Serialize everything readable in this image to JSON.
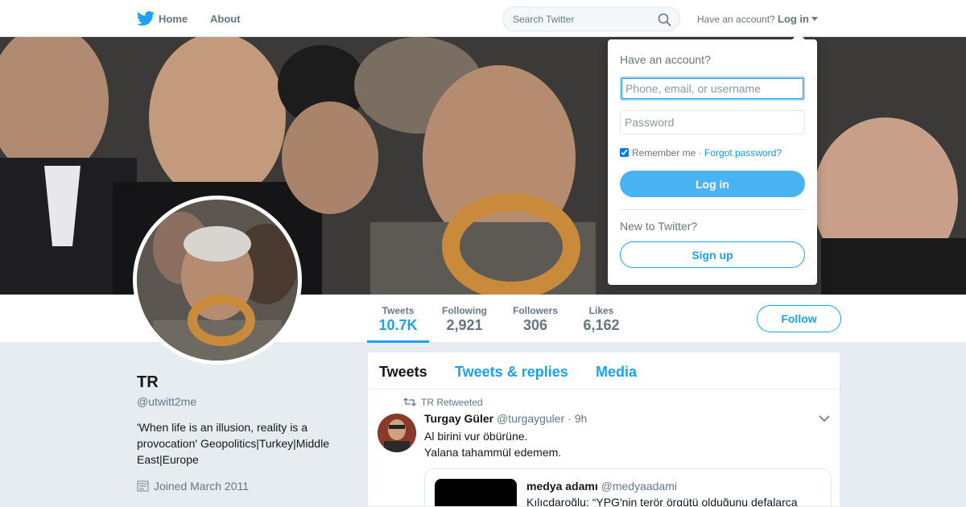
{
  "nav": {
    "home_label": "Home",
    "about_label": "About",
    "search_placeholder": "Search Twitter",
    "have_account": "Have an account?",
    "login_label": "Log in",
    "brand_icon": "twitter-bird-icon",
    "brand_color": "#1da1f2"
  },
  "stats": [
    {
      "label": "Tweets",
      "value": "10.7K"
    },
    {
      "label": "Following",
      "value": "2,921"
    },
    {
      "label": "Followers",
      "value": "306"
    },
    {
      "label": "Likes",
      "value": "6,162"
    }
  ],
  "follow_label": "Follow",
  "profile": {
    "name": "TR",
    "handle": "@utwitt2me",
    "bio": "'When life is an illusion, reality is a provocation' Geopolitics|Turkey|Middle East|Europe",
    "joined": "Joined March 2011"
  },
  "timeline": {
    "tabs": [
      "Tweets",
      "Tweets & replies",
      "Media"
    ],
    "retweet_label": "TR Retweeted",
    "tweet": {
      "name": "Turgay Güler",
      "handle": "@turgayguler",
      "time": "· 9h",
      "lines": [
        "Al birini vur öbürüne.",
        "Yalana tahammül edemem."
      ]
    },
    "quote": {
      "name": "medya adamı",
      "handle": "@medyaadami",
      "text": "Kılıçdaroğlu: “YPG'nin terör örgütü olduğunu defalarca"
    }
  },
  "login_dropdown": {
    "title": "Have an account?",
    "username_placeholder": "Phone, email, or username",
    "password_placeholder": "Password",
    "remember_label": "Remember me",
    "separator": " · ",
    "forgot_label": "Forgot password?",
    "login_button": "Log in",
    "new_label": "New to Twitter?",
    "signup_button": "Sign up"
  }
}
